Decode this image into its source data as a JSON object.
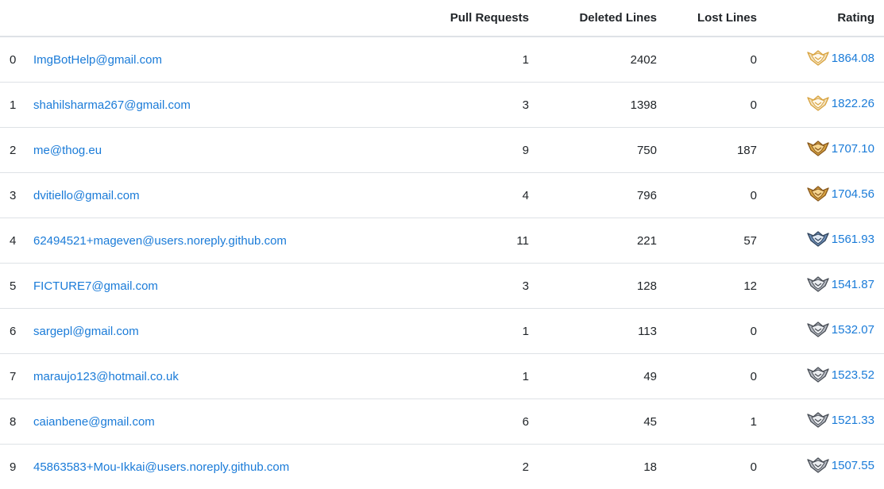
{
  "headers": {
    "index": "",
    "user": "",
    "pull_requests": "Pull Requests",
    "deleted_lines": "Deleted Lines",
    "lost_lines": "Lost Lines",
    "rating": "Rating"
  },
  "rows": [
    {
      "index": "0",
      "user": "ImgBotHelp@gmail.com",
      "pull_requests": "1",
      "deleted_lines": "2402",
      "lost_lines": "0",
      "rating": "1864.08",
      "badge": "gold-outline-badge-icon"
    },
    {
      "index": "1",
      "user": "shahilsharma267@gmail.com",
      "pull_requests": "3",
      "deleted_lines": "1398",
      "lost_lines": "0",
      "rating": "1822.26",
      "badge": "gold-outline-badge-icon"
    },
    {
      "index": "2",
      "user": "me@thog.eu",
      "pull_requests": "9",
      "deleted_lines": "750",
      "lost_lines": "187",
      "rating": "1707.10",
      "badge": "gold-badge-icon"
    },
    {
      "index": "3",
      "user": "dvitiello@gmail.com",
      "pull_requests": "4",
      "deleted_lines": "796",
      "lost_lines": "0",
      "rating": "1704.56",
      "badge": "gold-badge-icon"
    },
    {
      "index": "4",
      "user": "62494521+mageven@users.noreply.github.com",
      "pull_requests": "11",
      "deleted_lines": "221",
      "lost_lines": "57",
      "rating": "1561.93",
      "badge": "blue-silver-badge-icon"
    },
    {
      "index": "5",
      "user": "FICTURE7@gmail.com",
      "pull_requests": "3",
      "deleted_lines": "128",
      "lost_lines": "12",
      "rating": "1541.87",
      "badge": "silver-badge-icon"
    },
    {
      "index": "6",
      "user": "sargepl@gmail.com",
      "pull_requests": "1",
      "deleted_lines": "113",
      "lost_lines": "0",
      "rating": "1532.07",
      "badge": "silver-badge-icon"
    },
    {
      "index": "7",
      "user": "maraujo123@hotmail.co.uk",
      "pull_requests": "1",
      "deleted_lines": "49",
      "lost_lines": "0",
      "rating": "1523.52",
      "badge": "silver-badge-icon"
    },
    {
      "index": "8",
      "user": "caianbene@gmail.com",
      "pull_requests": "6",
      "deleted_lines": "45",
      "lost_lines": "1",
      "rating": "1521.33",
      "badge": "silver-badge-icon"
    },
    {
      "index": "9",
      "user": "45863583+Mou-Ikkai@users.noreply.github.com",
      "pull_requests": "2",
      "deleted_lines": "18",
      "lost_lines": "0",
      "rating": "1507.55",
      "badge": "silver-badge-icon"
    }
  ],
  "colors": {
    "link": "#1a7bd8",
    "text": "#212529",
    "border": "#dee2e6",
    "gold": "#d9a441",
    "gold_dark": "#8a5a1e",
    "silver": "#b8bcc4",
    "silver_dark": "#4a4f57",
    "blue_silver": "#6f8fb8"
  }
}
